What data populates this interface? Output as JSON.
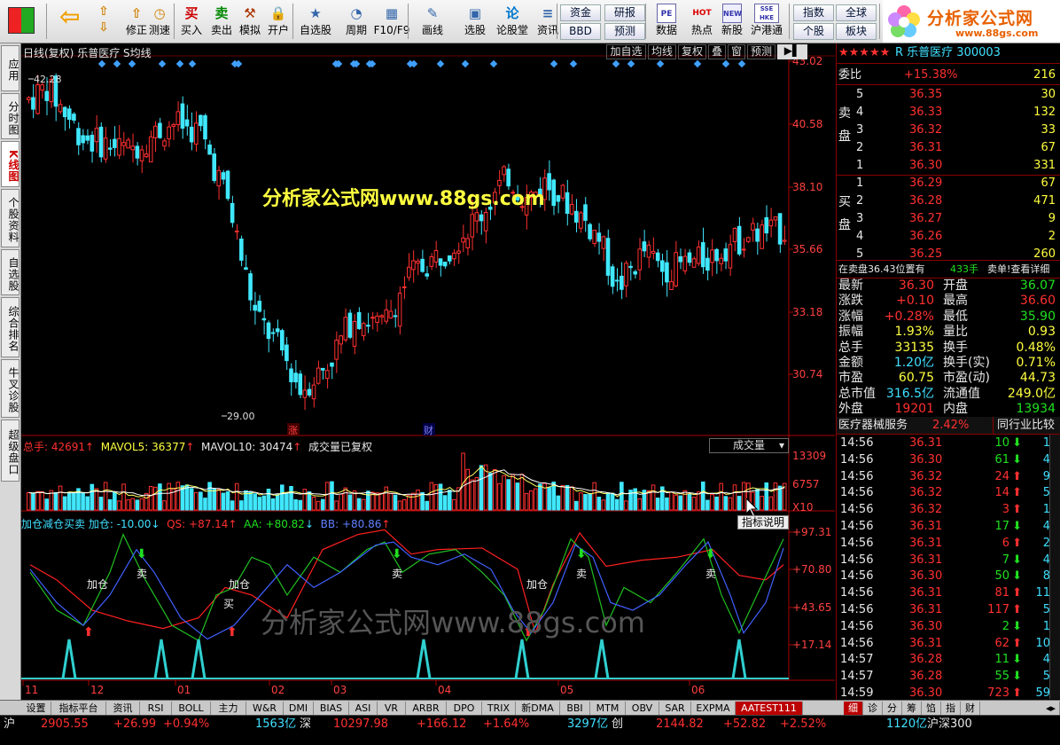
{
  "toolbar": {
    "buttons": [
      {
        "label": "修正",
        "icon": "⇧"
      },
      {
        "label": "测速",
        "icon": "◷"
      },
      {
        "label": "买入",
        "icon": "买"
      },
      {
        "label": "卖出",
        "icon": "卖"
      },
      {
        "label": "模拟",
        "icon": "⚒"
      },
      {
        "label": "开户",
        "icon": "🔒"
      },
      {
        "label": "自选股",
        "icon": "★"
      },
      {
        "label": "周期",
        "icon": "◔"
      },
      {
        "label": "F10/F9",
        "icon": "▦"
      },
      {
        "label": "画线",
        "icon": "✎"
      },
      {
        "label": "选股",
        "icon": "▣"
      },
      {
        "label": "论股堂",
        "icon": "论"
      },
      {
        "label": "资讯",
        "icon": "≡"
      }
    ],
    "small": [
      "资金",
      "BBD",
      "研报",
      "预测",
      "数据",
      "热点",
      "新股",
      "沪港通",
      "指数",
      "个股",
      "全球",
      "板块"
    ],
    "pills": [
      "PE",
      "HOT",
      "NEW",
      "SSE HKE"
    ]
  },
  "logo": {
    "name": "分析家公式网",
    "url": "www.88gs.com"
  },
  "left_tabs": [
    "应用",
    "分时图",
    "K线图",
    "个股资料",
    "自选股",
    "综合排名",
    "牛叉诊股",
    "超级盘口"
  ],
  "chart": {
    "title": "日线(复权)",
    "stock": "乐普医疗",
    "ma_label": "S均线",
    "header_buttons": [
      "加自选",
      "均线",
      "复权",
      "叠",
      "窗",
      "预测"
    ],
    "price_axis": [
      "43.02",
      "40.58",
      "38.10",
      "35.66",
      "33.18",
      "30.74"
    ],
    "high_label": "42.28",
    "low_label": "29.00",
    "marks": [
      "涨",
      "财"
    ],
    "watermark_top": "分析家公式网www.88gs.com",
    "watermark_bottom": "分析家公式网www.88gs.com",
    "volume_header": {
      "total": "总手: 42691",
      "mavol5": "MAVOL5: 36377",
      "mavol10": "MAVOL10: 30474",
      "note": "成交量已复权",
      "select": "成交量"
    },
    "volume_axis": [
      "13309",
      "6757",
      "X10"
    ],
    "indicator_header": {
      "name": "加仓减仓买卖",
      "jc": "加仓: -10.00",
      "qs": "QS: +87.14",
      "aa": "AA: +80.82",
      "bb": "BB: +80.86",
      "btn": "指标说明"
    },
    "indicator_axis": [
      "+97.31",
      "+70.80",
      "+43.65",
      "+17.14"
    ],
    "signals": {
      "add": "加仓",
      "sell": "卖",
      "buy": "买"
    },
    "months": [
      "11",
      "12",
      "01",
      "02",
      "03",
      "04",
      "05",
      "06"
    ],
    "colors": {
      "up": "#ff3030",
      "down": "#40e8ff",
      "qs": "#ff2020",
      "aa": "#20c020",
      "bb": "#4060ff"
    }
  },
  "quote": {
    "stars": "★★★★★",
    "code": "R 乐普医疗 300003",
    "weibi_label": "委比",
    "weibi": "+15.38%",
    "weibi_val": "216",
    "sell_label": "卖盘",
    "buy_label": "买盘",
    "asks": [
      {
        "n": "5",
        "p": "36.35",
        "v": "30"
      },
      {
        "n": "4",
        "p": "36.33",
        "v": "132"
      },
      {
        "n": "3",
        "p": "36.32",
        "v": "33"
      },
      {
        "n": "2",
        "p": "36.31",
        "v": "67"
      },
      {
        "n": "1",
        "p": "36.30",
        "v": "331"
      }
    ],
    "bids": [
      {
        "n": "1",
        "p": "36.29",
        "v": "67"
      },
      {
        "n": "2",
        "p": "36.28",
        "v": "471"
      },
      {
        "n": "3",
        "p": "36.27",
        "v": "9"
      },
      {
        "n": "4",
        "p": "36.26",
        "v": "2"
      },
      {
        "n": "5",
        "p": "36.25",
        "v": "260"
      }
    ],
    "note": "在卖盘36.43位置有",
    "note_vol": "433手",
    "note_tail": "卖单!查看详细",
    "stats": [
      [
        "最新",
        "36.30",
        "开盘",
        "36.07"
      ],
      [
        "涨跌",
        "+0.10",
        "最高",
        "36.60"
      ],
      [
        "涨幅",
        "+0.28%",
        "最低",
        "35.90"
      ],
      [
        "振幅",
        "1.93%",
        "量比",
        "0.93"
      ],
      [
        "总手",
        "33135",
        "换手",
        "0.48%"
      ],
      [
        "金额",
        "1.20亿",
        "换手(实)",
        "0.71%"
      ],
      [
        "市盈",
        "60.75",
        "市盈(动)",
        "44.73"
      ],
      [
        "总市值",
        "316.5亿",
        "流通值",
        "249.0亿"
      ],
      [
        "外盘",
        "19201",
        "内盘",
        "13934"
      ]
    ],
    "industry": "医疗器械服务",
    "industry_pct": "2.42%",
    "compare": "同行业比较",
    "ticks": [
      [
        "14:56",
        "36.31",
        "10",
        "d",
        "1"
      ],
      [
        "14:56",
        "36.30",
        "61",
        "d",
        "4"
      ],
      [
        "14:56",
        "36.32",
        "24",
        "u",
        "9"
      ],
      [
        "14:56",
        "36.32",
        "14",
        "u",
        "5"
      ],
      [
        "14:56",
        "36.32",
        "3",
        "u",
        "1"
      ],
      [
        "14:56",
        "36.31",
        "17",
        "d",
        "4"
      ],
      [
        "14:56",
        "36.31",
        "6",
        "u",
        "2"
      ],
      [
        "14:56",
        "36.31",
        "7",
        "d",
        "4"
      ],
      [
        "14:56",
        "36.30",
        "50",
        "d",
        "8"
      ],
      [
        "14:56",
        "36.31",
        "81",
        "u",
        "11"
      ],
      [
        "14:56",
        "36.31",
        "117",
        "u",
        "5"
      ],
      [
        "14:56",
        "36.30",
        "2",
        "d",
        "1"
      ],
      [
        "14:56",
        "36.31",
        "62",
        "u",
        "10"
      ],
      [
        "14:57",
        "36.28",
        "11",
        "d",
        "4"
      ],
      [
        "14:57",
        "36.28",
        "55",
        "d",
        "5"
      ],
      [
        "14:59",
        "36.30",
        "723",
        "u",
        "59"
      ]
    ],
    "side_tabs": [
      "细",
      "诊",
      "分",
      "筹",
      "馅",
      "指",
      "财"
    ]
  },
  "bottom_tabs": [
    "设置",
    "指标平台",
    "资讯",
    "RSI",
    "BOLL",
    "主力",
    "W&R",
    "DMI",
    "BIAS",
    "ASI",
    "VR",
    "ARBR",
    "DPO",
    "TRIX",
    "新DMA",
    "BBI",
    "MTM",
    "OBV",
    "SAR",
    "EXPMA",
    "AATEST111"
  ],
  "status": {
    "sh_label": "沪",
    "sh_idx": "2905.55",
    "sh_chg": "+26.99",
    "sh_pct": "+0.94%",
    "sh_amt": "1563亿",
    "sz_label": "深",
    "sz_idx": "10297.98",
    "sz_chg": "+166.12",
    "sz_pct": "+1.64%",
    "sz_amt": "3297亿",
    "cy_label": "创",
    "cy_idx": "2144.82",
    "cy_chg": "+52.82",
    "cy_pct": "+2.52%",
    "cy_amt": "1120亿",
    "hs_label": "沪深300"
  }
}
